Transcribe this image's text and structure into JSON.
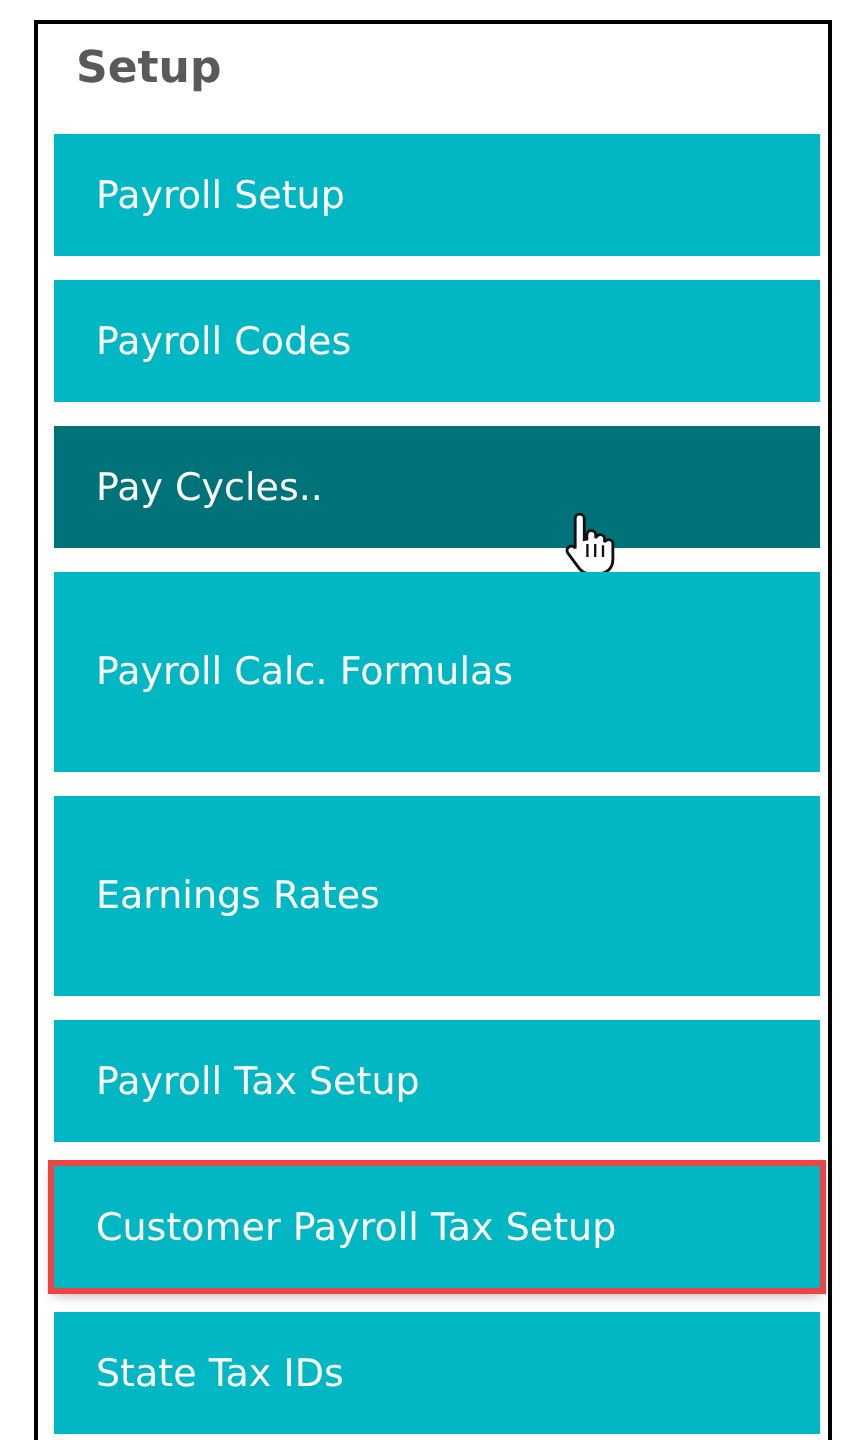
{
  "panel": {
    "title": "Setup"
  },
  "tiles": [
    {
      "label": "Payroll Setup",
      "kind": "short",
      "hovered": false,
      "highlighted": false
    },
    {
      "label": "Payroll Codes",
      "kind": "short",
      "hovered": false,
      "highlighted": false
    },
    {
      "label": "Pay Cycles..",
      "kind": "short",
      "hovered": true,
      "highlighted": false
    },
    {
      "label": "Payroll Calc. Formulas",
      "kind": "tall",
      "hovered": false,
      "highlighted": false
    },
    {
      "label": "Earnings Rates",
      "kind": "tall",
      "hovered": false,
      "highlighted": false
    },
    {
      "label": "Payroll Tax Setup",
      "kind": "short",
      "hovered": false,
      "highlighted": false
    },
    {
      "label": "Customer Payroll Tax Setup",
      "kind": "short",
      "hovered": false,
      "highlighted": true
    },
    {
      "label": "State Tax IDs",
      "kind": "short",
      "hovered": false,
      "highlighted": false
    }
  ]
}
